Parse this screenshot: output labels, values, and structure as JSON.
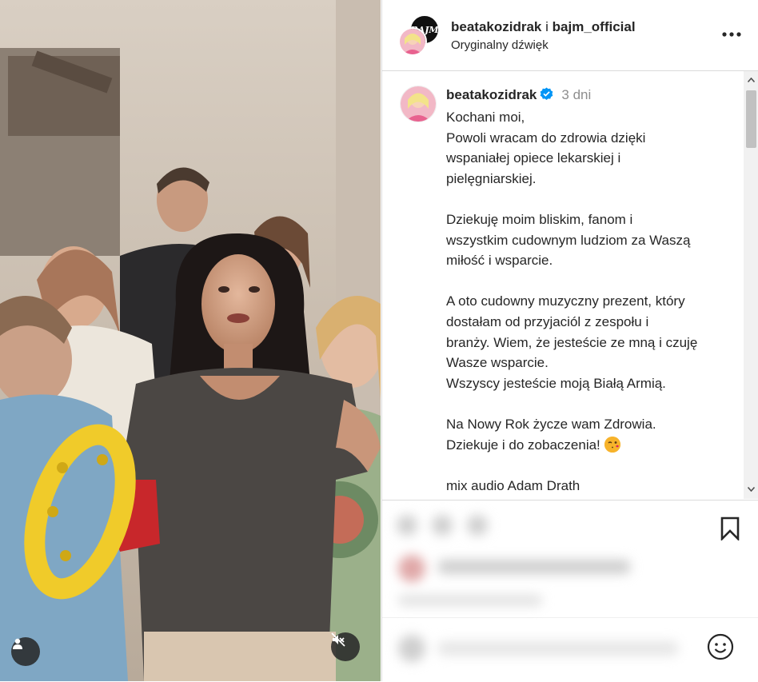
{
  "post": {
    "owner_primary": "beatakozidrak",
    "owner_joiner": "i",
    "owner_collab": "bajm_official",
    "audio": "Oryginalny dźwięk",
    "collab_avatar_text": "BAJM"
  },
  "caption": {
    "username": "beatakozidrak",
    "time": "3 dni",
    "lines": {
      "l1": "Kochani moi,",
      "l2": "Powoli wracam do zdrowia dzięki",
      "l3": "wspaniałej opiece lekarskiej i",
      "l4": "pielęgniarskiej.",
      "l5": "Dziekuję moim bliskim, fanom i",
      "l6": "wszystkim cudownym ludziom za Waszą",
      "l7": "miłość i wsparcie.",
      "l8": "A oto cudowny muzyczny prezent, który",
      "l9": "dostałam od przyjaciól z zespołu i",
      "l10": "branży. Wiem, że jesteście ze mną i czuję",
      "l11": "Wasze wsparcie.",
      "l12": "Wszyscy jesteście moją Białą Armią.",
      "l13": "Na Nowy Rok życze wam Zdrowia.",
      "l14": "Dziekuje i do zobaczenia!",
      "l15": "mix audio Adam Drath"
    }
  },
  "icons": {
    "more": "more-icon",
    "verified": "verified-badge-icon",
    "bookmark": "bookmark-icon",
    "emoji": "emoji-icon",
    "tag": "user-tag-icon",
    "mute": "muted-speaker-icon",
    "wink": "winking-kiss-emoji"
  },
  "colors": {
    "verified": "#0095f6",
    "text": "#262626",
    "muted": "#8e8e8e"
  }
}
